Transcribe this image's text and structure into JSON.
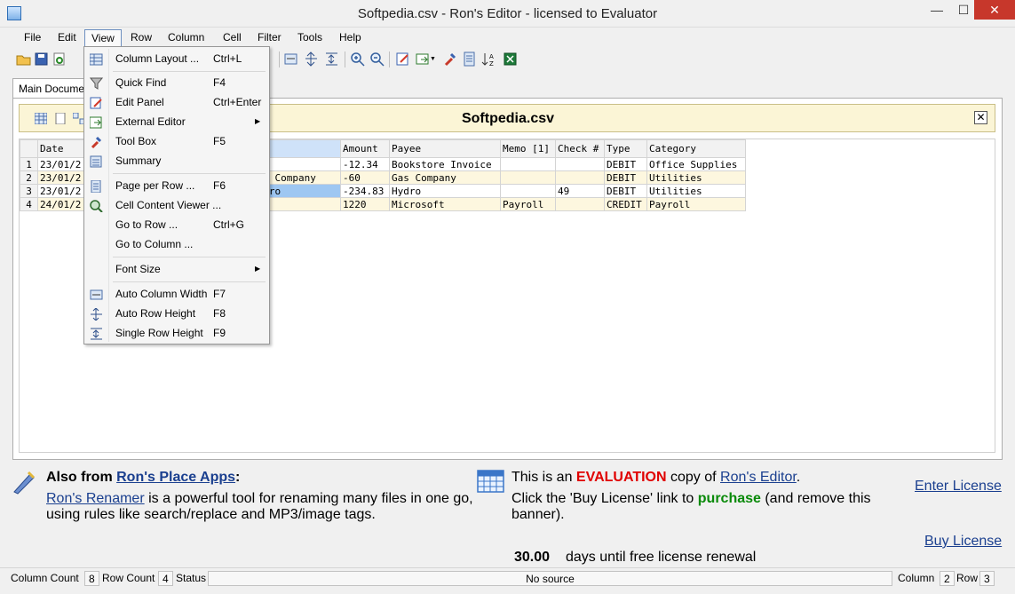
{
  "window": {
    "title": "Softpedia.csv - Ron's Editor - licensed to Evaluator",
    "min": "—",
    "max": "☐",
    "close": "✕"
  },
  "menubar": [
    "File",
    "Edit",
    "View",
    "Row",
    "Column",
    "Cell",
    "Filter",
    "Tools",
    "Help"
  ],
  "tab": {
    "label": "Main Document"
  },
  "file_header": {
    "title": "Softpedia.csv",
    "close": "✕"
  },
  "grid": {
    "columns": [
      "Date",
      "",
      "Amount",
      "Payee",
      "Memo [1]",
      "Check #",
      "Type",
      "Category"
    ],
    "rows": [
      {
        "num": "1",
        "cells": [
          "23/01/2",
          "",
          "-12.34",
          "Bookstore Invoice",
          "",
          "",
          "DEBIT",
          "Office Supplies"
        ]
      },
      {
        "num": "2",
        "cells": [
          "23/01/2",
          "Gas Company",
          "-60",
          "Gas Company",
          "",
          "",
          "DEBIT",
          "Utilities"
        ]
      },
      {
        "num": "3",
        "cells": [
          "23/01/2",
          "Hydro",
          "-234.83",
          "Hydro",
          "",
          "49",
          "DEBIT",
          "Utilities"
        ]
      },
      {
        "num": "4",
        "cells": [
          "24/01/2",
          "",
          "1220",
          "Microsoft",
          "Payroll",
          "",
          "CREDIT",
          "Payroll"
        ]
      }
    ]
  },
  "view_menu": {
    "items": [
      {
        "label": "Column Layout ...",
        "key": "Ctrl+L"
      },
      {
        "label": "Quick Find",
        "key": "F4"
      },
      {
        "label": "Edit Panel",
        "key": "Ctrl+Enter"
      },
      {
        "label": "External Editor",
        "key": ""
      },
      {
        "label": "Tool Box",
        "key": "F5"
      },
      {
        "label": "Summary",
        "key": ""
      },
      {
        "label": "Page per Row ...",
        "key": "F6"
      },
      {
        "label": "Cell Content Viewer ...",
        "key": ""
      },
      {
        "label": "Go to Row ...",
        "key": "Ctrl+G"
      },
      {
        "label": "Go to Column ...",
        "key": ""
      },
      {
        "label": "Font Size",
        "key": ""
      },
      {
        "label": "Auto Column Width",
        "key": "F7"
      },
      {
        "label": "Auto Row Height",
        "key": "F8"
      },
      {
        "label": "Single Row Height",
        "key": "F9"
      }
    ],
    "submenu_arrow": "▶"
  },
  "banner": {
    "also_from": "Also from ",
    "apps_link": "Ron's Place Apps",
    "colon": ":",
    "renamer_link": "Ron's Renamer",
    "renamer_text1": " is a powerful tool for renaming many files in one go,",
    "renamer_text2": "using rules like search/replace and MP3/image tags.",
    "eval_pre": "This is an ",
    "eval_word": "EVALUATION",
    "eval_mid": " copy of ",
    "editor_link": "Ron's Editor",
    "eval_post": ".",
    "click_pre": "Click the 'Buy License' link to ",
    "purchase": "purchase",
    "click_post": " (and remove this",
    "banner_word": "banner).",
    "days_value": "30.00",
    "days_text": "days until free license renewal",
    "enter_license": "Enter License",
    "buy_license": "Buy License"
  },
  "statusbar": {
    "column_count_label": "Column Count",
    "column_count": "8",
    "row_count_label": "Row Count",
    "row_count": "4",
    "status_label": "Status",
    "source": "No source",
    "column_label": "Column",
    "column": "2",
    "row_label": "Row",
    "row": "3"
  },
  "colors": {
    "accent_link": "#1a3f8f",
    "evaluation_red": "#e00000",
    "purchase_green": "#0a8a0a",
    "header_bg": "#fbf5d6"
  }
}
